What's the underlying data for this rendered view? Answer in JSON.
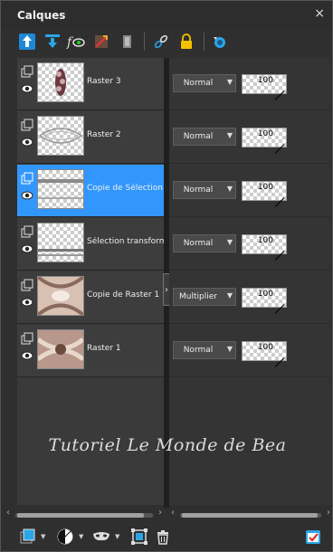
{
  "panel": {
    "title": "Calques",
    "close_label": "×"
  },
  "toolbar": {
    "icons": [
      "arrow-up-icon",
      "arrow-down-icon",
      "fx-effects-icon",
      "brush-edit-icon",
      "mask-icon",
      "link-icon",
      "lock-icon",
      "refresh-icon"
    ]
  },
  "layers": [
    {
      "name": "Raster 3",
      "blend": "Normal",
      "opacity": "100",
      "selected": false
    },
    {
      "name": "Raster 2",
      "blend": "Normal",
      "opacity": "100",
      "selected": false
    },
    {
      "name": "Copie de Sélection tra",
      "blend": "Normal",
      "opacity": "100",
      "selected": true
    },
    {
      "name": "Sélection transformée",
      "blend": "Normal",
      "opacity": "100",
      "selected": false
    },
    {
      "name": "Copie de Raster 1",
      "blend": "Multiplier",
      "opacity": "100",
      "selected": false
    },
    {
      "name": "Raster 1",
      "blend": "Normal",
      "opacity": "100",
      "selected": false
    }
  ],
  "watermark": "Tutoriel Le Monde de Bea",
  "bottom_toolbar": {
    "icons": [
      "new-layer-icon",
      "adjustment-layer-icon",
      "mask-layer-icon",
      "group-icon",
      "delete-icon",
      "properties-icon"
    ]
  },
  "colors": {
    "selected": "#3297fd",
    "accent_icon": "#2aa6e8"
  }
}
